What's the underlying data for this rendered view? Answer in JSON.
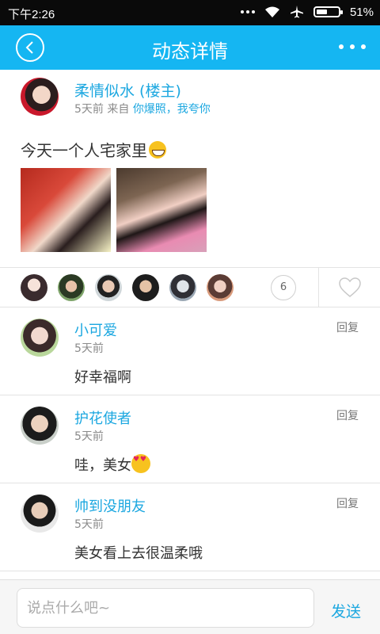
{
  "status_bar": {
    "time": "下午2:26",
    "battery": "51%",
    "battery_level": 0.51,
    "icons": [
      "more-dots-icon",
      "wifi-icon",
      "airplane-icon",
      "battery-icon"
    ]
  },
  "header": {
    "title": "动态详情",
    "back_icon": "back-icon",
    "more_icon": "more-dots-icon",
    "color": "#15b6f2"
  },
  "post": {
    "author": "柔情似水 (楼主)",
    "time": "5天前 来自",
    "source": "你爆照，我夸你",
    "text": "今天一个人宅家里",
    "emoji": "grin-emoji",
    "photos": [
      "photo-girl-1",
      "photo-girl-2"
    ]
  },
  "likes": {
    "count": "6",
    "avatar_count": 6,
    "heart_icon": "heart-icon"
  },
  "comments": [
    {
      "name": "小可爱",
      "time": "5天前",
      "reply": "回复",
      "text": "好幸福啊"
    },
    {
      "name": "护花使者",
      "time": "5天前",
      "reply": "回复",
      "text": "哇，美女",
      "emoji": "heart-eyes-emoji"
    },
    {
      "name": "帅到没朋友",
      "time": "5天前",
      "reply": "回复",
      "text": "美女看上去很温柔哦"
    }
  ],
  "composer": {
    "placeholder": "说点什么吧~",
    "send": "发送"
  },
  "accent_color": "#1ba7e0"
}
